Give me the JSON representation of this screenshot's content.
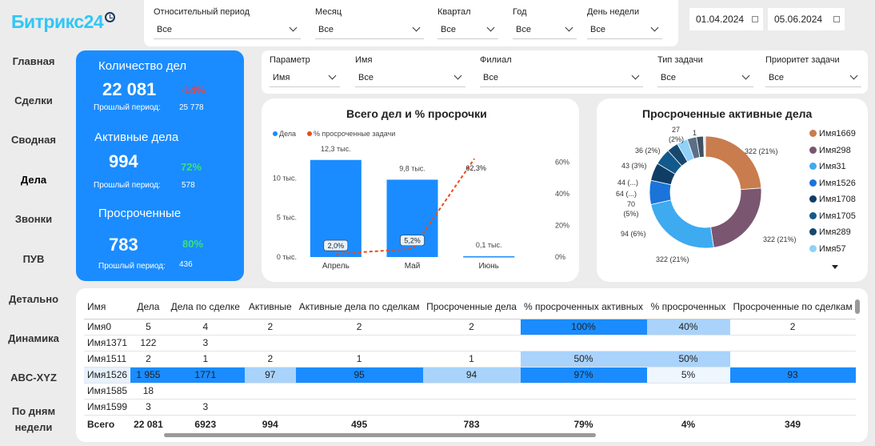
{
  "brand": {
    "name_prefix": "Битрикс",
    "name_suffix": "24"
  },
  "top_filters": [
    {
      "label": "Относительный период",
      "value": "Все"
    },
    {
      "label": "Месяц",
      "value": "Все"
    },
    {
      "label": "Квартал",
      "value": "Все"
    },
    {
      "label": "Год",
      "value": "Все"
    },
    {
      "label": "День недели",
      "value": "Все"
    }
  ],
  "dates": {
    "from": "01.04.2024",
    "to": "05.06.2024"
  },
  "nav": [
    "Главная",
    "Сделки",
    "Сводная",
    "Дела",
    "Звонки",
    "ПУВ",
    "Детально",
    "Динамика",
    "ABC-XYZ",
    "По дням недели"
  ],
  "kpi": {
    "total": {
      "title": "Количество дел",
      "value": "22 081",
      "change": "-14%",
      "prev_label": "Прошлый период:",
      "prev_value": "25 778"
    },
    "active": {
      "title": "Активные дела",
      "value": "994",
      "change": "72%",
      "prev_label": "Прошлый период:",
      "prev_value": "578"
    },
    "overdue": {
      "title": "Просроченные",
      "value": "783",
      "change": "80%",
      "prev_label": "Прошлый период:",
      "prev_value": "436"
    }
  },
  "colors": {
    "accent": "#1a8cff",
    "negative": "#ff3b3b",
    "positive": "#39e07a",
    "line": "#e84c1e"
  },
  "mid_filters": [
    {
      "label": "Параметр",
      "value": "Имя"
    },
    {
      "label": "Имя",
      "value": "Все"
    },
    {
      "label": "Филиал",
      "value": "Все"
    },
    {
      "label": "Тип задачи",
      "value": "Все"
    },
    {
      "label": "Приоритет задачи",
      "value": "Все"
    }
  ],
  "chart_data": [
    {
      "type": "bar",
      "title": "Всего дел и % просрочки",
      "categories": [
        "Апрель",
        "Май",
        "Июнь"
      ],
      "series": [
        {
          "name": "Дела",
          "values": [
            12300,
            9800,
            100
          ],
          "labels": [
            "12,3 тыс.",
            "9,8 тыс.",
            "0,1 тыс."
          ]
        },
        {
          "name": "% просроченные задачи",
          "values": [
            2.0,
            5.2,
            62.3
          ],
          "labels": [
            "2,0%",
            "5,2%",
            "62,3%"
          ]
        }
      ],
      "y_left_ticks": [
        "0 тыс.",
        "5 тыс.",
        "10 тыс."
      ],
      "y_right_ticks": [
        "0%",
        "20%",
        "40%",
        "60%"
      ],
      "ylim_left": [
        0,
        14000
      ],
      "ylim_right": [
        0,
        70
      ]
    },
    {
      "type": "pie",
      "title": "Просроченные активные дела",
      "slices": [
        {
          "name": "Имя1669",
          "value": 322,
          "label": "322 (21%)",
          "color": "#c97c4e"
        },
        {
          "name": "Имя298",
          "value": 322,
          "label": "322 (21%)",
          "color": "#7a5670"
        },
        {
          "name": "Имя31",
          "value": 322,
          "label": "322 (21%)",
          "color": "#3eaaf0"
        },
        {
          "name": "Имя1526",
          "value": 94,
          "label": "94 (6%)",
          "color": "#1a74d9"
        },
        {
          "name": "Имя1708",
          "value": 70,
          "label": "70 (5%)",
          "color": "#0f3d66"
        },
        {
          "name": "Имя1705",
          "value": 64,
          "label": "64 (...)",
          "color": "#125a8c"
        },
        {
          "name": "Имя289",
          "value": 44,
          "label": "44 (...)",
          "color": "#16486e"
        },
        {
          "name": "Имя57",
          "value": 43,
          "label": "43 (3%)",
          "color": "#8fd1f7"
        },
        {
          "name": "",
          "value": 36,
          "label": "36 (2%)",
          "color": "#5a6f86"
        },
        {
          "name": "",
          "value": 27,
          "label": "27 (2%)",
          "color": "#3f5063"
        },
        {
          "name": "",
          "value": 4,
          "label": "",
          "color": "#9aa5b1"
        },
        {
          "name": "",
          "value": 3,
          "label": "",
          "color": "#2f2f2f"
        },
        {
          "name": "",
          "value": 1,
          "label": "1",
          "color": "#cfd8e0"
        }
      ],
      "legend": [
        "Имя1669",
        "Имя298",
        "Имя31",
        "Имя1526",
        "Имя1708",
        "Имя1705",
        "Имя289",
        "Имя57"
      ]
    }
  ],
  "table": {
    "headers": [
      "Имя",
      "Дела",
      "Дела по сделке",
      "Активные",
      "Активные дела по сделкам",
      "Просроченные дела",
      "% просроченных активных",
      "% просроченных",
      "Просроченные по сделкам"
    ],
    "rows": [
      [
        "Имя0",
        "5",
        "4",
        "2",
        "2",
        "2",
        "100%",
        "40%",
        "2"
      ],
      [
        "Имя1371",
        "122",
        "3",
        "",
        "",
        "",
        "",
        "",
        ""
      ],
      [
        "Имя1511",
        "2",
        "1",
        "2",
        "1",
        "1",
        "50%",
        "50%",
        ""
      ],
      [
        "Имя1526",
        "1 955",
        "1771",
        "97",
        "95",
        "94",
        "97%",
        "5%",
        "93"
      ],
      [
        "Имя1585",
        "18",
        "",
        "",
        "",
        "",
        "",
        "",
        ""
      ],
      [
        "Имя1599",
        "3",
        "3",
        "",
        "",
        "",
        "",
        "",
        ""
      ]
    ],
    "total": [
      "Всего",
      "22 081",
      "6923",
      "994",
      "495",
      "783",
      "79%",
      "4%",
      "349"
    ]
  }
}
